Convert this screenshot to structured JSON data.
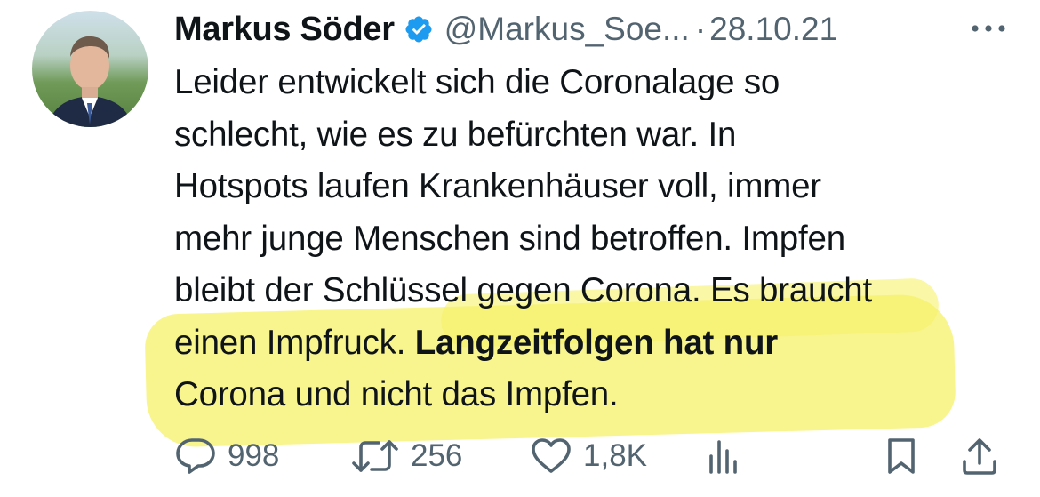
{
  "author": {
    "name": "Markus Söder",
    "handle": "@Markus_Soe...",
    "separator": "·",
    "date": "28.10.21"
  },
  "tweet": {
    "lines": [
      "Leider entwickelt sich die Coronalage so",
      "schlecht, wie es zu befürchten war. In",
      "Hotspots laufen Krankenhäuser voll, immer",
      "mehr junge Menschen sind betroffen. Impfen",
      "bleibt der Schlüssel gegen Corona. Es braucht"
    ],
    "line6_regular": "einen Impfruck. ",
    "line6_bold": "Langzeitfolgen hat nur",
    "line7": "Corona und nicht das Impfen."
  },
  "actions": {
    "replies": "998",
    "retweets": "256",
    "likes": "1,8K"
  },
  "icons": {
    "verified": "verified-badge-icon",
    "more": "more-icon",
    "reply": "reply-icon",
    "retweet": "retweet-icon",
    "like": "heart-icon",
    "views": "views-icon",
    "bookmark": "bookmark-icon",
    "share": "share-icon"
  },
  "colors": {
    "text": "#0f1419",
    "secondary": "#536471",
    "verified": "#1d9bf0",
    "highlight": "#f6f26a"
  }
}
